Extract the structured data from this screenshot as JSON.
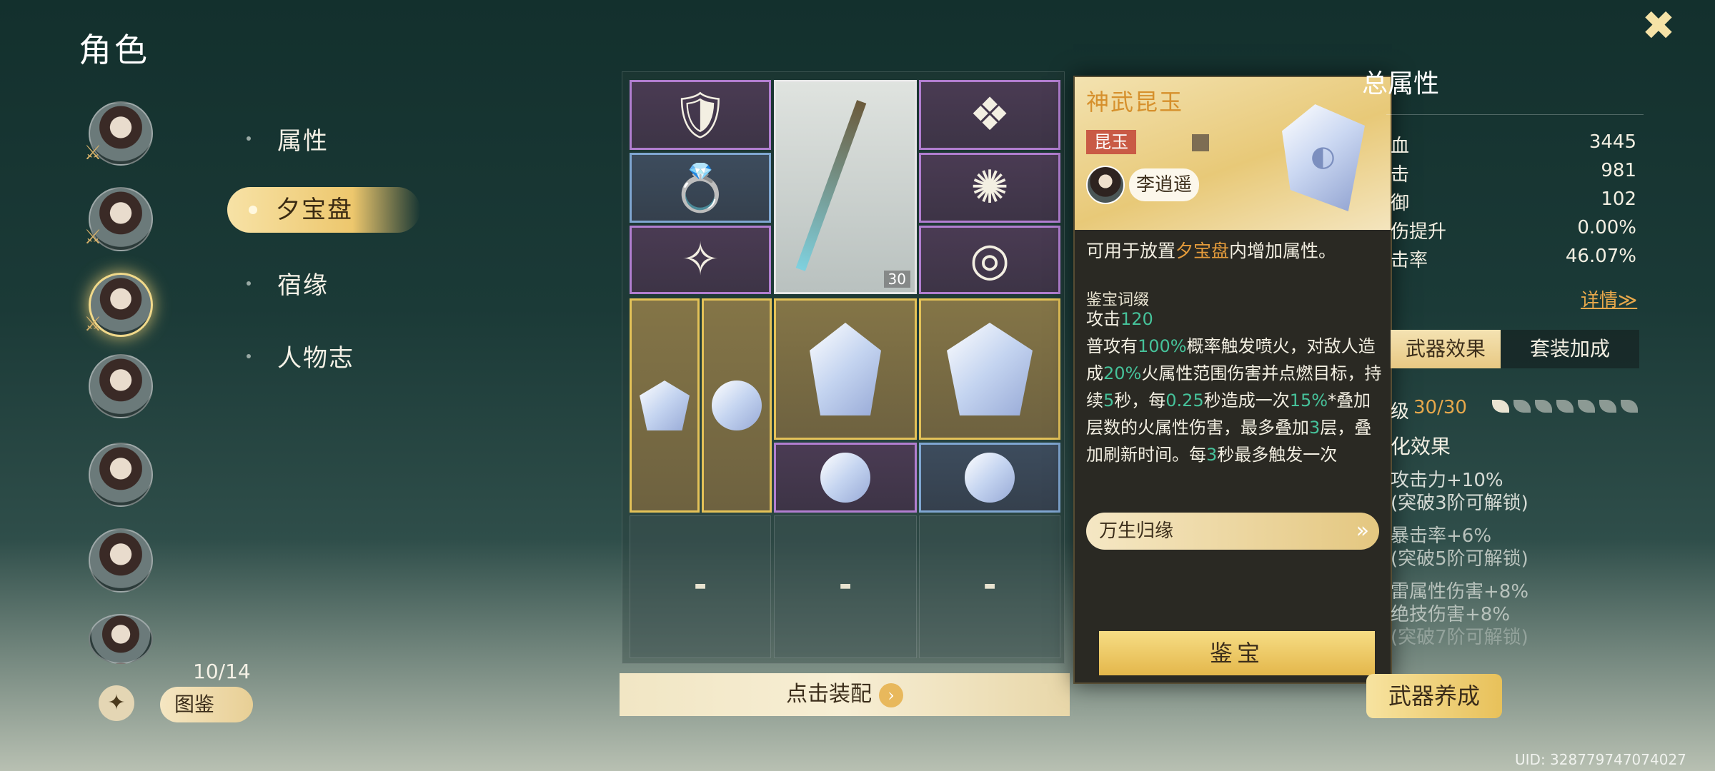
{
  "page_title": "角色",
  "menu": {
    "attributes": "属性",
    "treasure_board": "夕宝盘",
    "fate": "宿缘",
    "biography": "人物志"
  },
  "character_count": "10/14",
  "handbook_label": "图鉴",
  "grid": {
    "weapon_level": "30",
    "equip_button": "点击装配"
  },
  "tooltip": {
    "title": "神武昆玉",
    "tag": "昆玉",
    "owner": "李逍遥",
    "desc_prefix": "可用于放置",
    "desc_highlight": "夕宝盘",
    "desc_suffix": "内增加属性。",
    "section_title": "鉴宝词缀",
    "attack_label": "攻击",
    "attack_value": "120",
    "body": {
      "p1": "普攻有",
      "v1": "100%",
      "p2": "概率触发喷火，对敌人造成",
      "v2": "20%",
      "p3": "火属性范围伤害并点燃目标，持续",
      "v3": "5",
      "p4": "秒，每",
      "v4": "0.25",
      "p5": "秒造成一次",
      "v5": "15%",
      "p6": "*叠加层数的火属性伤害，最多叠加",
      "v6": "3",
      "p7": "层，叠加刷新时间。每",
      "v7": "3",
      "p8": "秒最多触发一次"
    },
    "set_name": "万生归缘",
    "appraise_button": "鉴宝"
  },
  "right_panel": {
    "title": "总属性",
    "stats": [
      {
        "label": "血",
        "value": "3445"
      },
      {
        "label": "击",
        "value": "981"
      },
      {
        "label": "御",
        "value": "102"
      },
      {
        "label": "伤提升",
        "value": "0.00%"
      },
      {
        "label": "击率",
        "value": "46.07%"
      }
    ],
    "detail_link": "详情≫",
    "tabs": [
      "武器效果",
      "套装加成"
    ],
    "level_label": "级",
    "level_value": "30/30",
    "effect_header": "化效果",
    "effects": [
      "攻击力+10%",
      "(突破3阶可解锁)",
      "暴击率+6%",
      "(突破5阶可解锁)",
      "雷属性伤害+8%",
      "绝技伤害+8%",
      "(突破7阶可解锁)"
    ],
    "cultivate_button": "武器养成"
  },
  "uid": "UID: 328779747074027"
}
